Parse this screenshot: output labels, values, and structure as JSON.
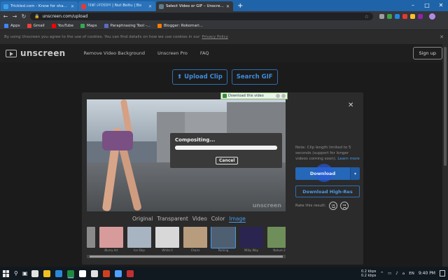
{
  "browser": {
    "tabs": [
      {
        "title": "Trickled.com - Know for sharing",
        "color": "#3aa0e6",
        "active": false
      },
      {
        "title": "রিক্সা নোহেরিস | Nut Boltu | Bo",
        "color": "#e53935",
        "active": false
      },
      {
        "title": "Select Video or GIF – Unscreen",
        "color": "#607d8b",
        "active": true
      }
    ],
    "new_tab": "+",
    "window_controls": [
      "–",
      "□",
      "✕"
    ],
    "url": "unscreen.com/upload",
    "bookmarks": [
      {
        "label": "Apps",
        "color": "#4285f4"
      },
      {
        "label": "Gmail",
        "color": "#ea4335"
      },
      {
        "label": "YouTube",
        "color": "#ff0000"
      },
      {
        "label": "Maps",
        "color": "#34a853"
      },
      {
        "label": "Paraphrasing Tool -...",
        "color": "#5c6bc0"
      },
      {
        "label": "Blogger: Rokomari...",
        "color": "#f57c00"
      }
    ]
  },
  "cookie_bar": {
    "text": "By using Unscreen you agree to the use of cookies. You can find details on how we use cookies in our",
    "link": "Privacy Policy",
    "close": "✕"
  },
  "header": {
    "logo": "unscreen",
    "nav": [
      "Remove Video Background",
      "Unscreen Pro",
      "FAQ"
    ],
    "signup": "Sign up"
  },
  "upload": {
    "upload_clip": "Upload Clip",
    "search_gif": "Search GIF"
  },
  "download_badge": {
    "label": "Download this video"
  },
  "modal": {
    "title": "Compositing...",
    "progress": 1.0,
    "cancel": "Cancel"
  },
  "editor": {
    "close": "✕",
    "watermark": "unscreen",
    "tabs": [
      {
        "label": "Original",
        "active": false
      },
      {
        "label": "Transparent",
        "active": false
      },
      {
        "label": "Video",
        "active": false
      },
      {
        "label": "Color",
        "active": false
      },
      {
        "label": "Image",
        "active": true
      }
    ],
    "thumbnails": [
      {
        "caption": "",
        "color": "#8a8a8a"
      },
      {
        "caption": "Blurry Art",
        "color": "#d79b9b"
      },
      {
        "caption": "Ice Ship",
        "color": "#a8b4c2"
      },
      {
        "caption": "White II",
        "color": "#d8d8d8"
      },
      {
        "caption": "Chairs",
        "color": "#b89c7e"
      },
      {
        "caption": "Parking",
        "color": "#4f5f72",
        "selected": true
      },
      {
        "caption": "Milky Way",
        "color": "#2a2450"
      },
      {
        "caption": "Nature 2",
        "color": "#6f8f5a"
      }
    ]
  },
  "side": {
    "note": "Note: Clip length limited to 5 seconds (support for longer videos coming soon).",
    "learn_more": "Learn more",
    "download": "Download",
    "caret": "▾",
    "download_hires": "Download High-Res",
    "rate": "Rate this result:"
  },
  "taskbar": {
    "apps": [
      "#e0e0e0",
      "#f0c020",
      "#2b88d8",
      "#1e8a3c",
      "#ffffff",
      "#e0e0e0",
      "#d04020",
      "#4fa0ff",
      "#c03030"
    ],
    "net_up": "0.2 kbps",
    "net_down": "0.2 kbps",
    "lang": "EN",
    "time": "9:40 PM",
    "tray_icons": [
      "^",
      "▭",
      "♪",
      "⌂"
    ]
  }
}
